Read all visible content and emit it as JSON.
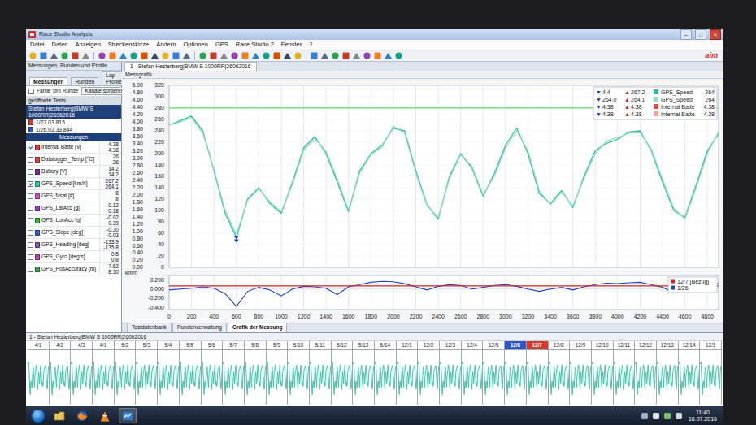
{
  "window": {
    "title": "Race Studio Analysis",
    "controls": [
      "–",
      "□",
      "×"
    ],
    "logo": "aim"
  },
  "menu": [
    "Datei",
    "Daten",
    "Anzeigen",
    "Streckenskizze",
    "Ändern",
    "Optionen",
    "GPS",
    "Race Studio 2",
    "Fenster",
    "?"
  ],
  "sidebar": {
    "title": "Messungen, Runden und Profile",
    "tabs": [
      {
        "label": "Messungen",
        "selected": true
      },
      {
        "label": "Runden",
        "selected": false
      },
      {
        "label": "Lap Profile",
        "selected": false
      }
    ],
    "color_per_lap": {
      "label": "Farbe 'pro Runde'",
      "checked": false
    },
    "sort_button": "Kanäle sortieren",
    "tests_header": "geöffnete Tests",
    "test_name": "Stefan Hesterberg|BMW S 1000RR|26062016",
    "laps": [
      {
        "label": "1/27.03.815",
        "color": "#d63a2f"
      },
      {
        "label": "1/26.02.33.844",
        "color": "#2f56c4"
      }
    ],
    "measures_header": "Messungen",
    "channels": [
      {
        "name": "Internal Batte",
        "unit": "[V]",
        "values": [
          "4.38",
          "4.38"
        ],
        "checked": true,
        "color": "#e03030"
      },
      {
        "name": "Datalogger_Temp",
        "unit": "[°C]",
        "values": [
          "26",
          "26"
        ],
        "checked": false,
        "color": "#d04848"
      },
      {
        "name": "Battery",
        "unit": "[V]",
        "values": [
          "14.2",
          "14.2"
        ],
        "checked": false,
        "color": "#7030a0"
      },
      {
        "name": "GPS_Speed",
        "unit": "[km/h]",
        "values": [
          "267.2",
          "264.1"
        ],
        "checked": true,
        "color": "#2fbf9f"
      },
      {
        "name": "GPS_Nsat",
        "unit": "[#]",
        "values": [
          "8",
          "8"
        ],
        "checked": false,
        "color": "#d050c0"
      },
      {
        "name": "GPS_LatAcc",
        "unit": "[g]",
        "values": [
          "0.12",
          "0.18"
        ],
        "checked": false,
        "color": "#9040c0"
      },
      {
        "name": "GPS_LonAcc",
        "unit": "[g]",
        "values": [
          "-0.02",
          "0.39"
        ],
        "checked": false,
        "color": "#40b040"
      },
      {
        "name": "GPS_Slope",
        "unit": "[deg]",
        "values": [
          "-0.30",
          "-0.03"
        ],
        "checked": false,
        "color": "#3060d0"
      },
      {
        "name": "GPS_Heading",
        "unit": "[deg]",
        "values": [
          "-133.9",
          "-135.8"
        ],
        "checked": false,
        "color": "#8050b0"
      },
      {
        "name": "GPS_Gyro",
        "unit": "[deg/s]",
        "values": [
          "0.5",
          "0.8"
        ],
        "checked": false,
        "color": "#c040a0"
      },
      {
        "name": "GPS_PosAccuracy",
        "unit": "[m]",
        "values": [
          "7.62",
          "8.30"
        ],
        "checked": false,
        "color": "#30a050"
      }
    ]
  },
  "chart": {
    "tab": "1 - Stefan Hesterberg|BMW S 1000RR|26062016",
    "title": "Messgrafik",
    "left_ticks": [
      "5.00",
      "4.80",
      "4.60",
      "4.40",
      "4.20",
      "4.00",
      "3.80",
      "3.60",
      "3.40",
      "3.20",
      "3.00",
      "2.80",
      "2.60",
      "2.40",
      "2.20",
      "2.00",
      "1.80",
      "1.60",
      "1.40",
      "1.20",
      "1.00",
      "0.80",
      "0.60",
      "0.40",
      "0.20",
      "0.00"
    ],
    "right_ticks": [
      "320",
      "300",
      "280",
      "260",
      "240",
      "220",
      "200",
      "180",
      "160",
      "140",
      "120",
      "100",
      "80",
      "60",
      "40",
      "20",
      "0"
    ],
    "x_ticks": [
      "0",
      "200",
      "400",
      "600",
      "800",
      "1000",
      "1200",
      "1400",
      "1600",
      "1800",
      "2000",
      "2200",
      "2400",
      "2600",
      "2800",
      "3000",
      "3200",
      "3400",
      "3600",
      "3800",
      "4000",
      "4200",
      "4400",
      "4600",
      "4800"
    ],
    "x_values": [
      0,
      100,
      200,
      300,
      400,
      500,
      600,
      700,
      800,
      900,
      1000,
      1100,
      1200,
      1300,
      1400,
      1500,
      1600,
      1700,
      1800,
      1900,
      2000,
      2100,
      2200,
      2300,
      2400,
      2500,
      2600,
      2700,
      2800,
      2900,
      3000,
      3100,
      3200,
      3300,
      3400,
      3500,
      3600,
      3700,
      3800,
      3900,
      4000,
      4100,
      4200,
      4300,
      4400,
      4500,
      4600,
      4700,
      4800,
      4900
    ],
    "series": [
      {
        "axis": "right",
        "color": "#2fbf9f",
        "values": [
          250,
          258,
          266,
          240,
          170,
          95,
          52,
          120,
          140,
          112,
          95,
          150,
          210,
          230,
          200,
          150,
          98,
          170,
          200,
          215,
          245,
          240,
          170,
          110,
          85,
          160,
          200,
          175,
          125,
          165,
          215,
          245,
          200,
          130,
          112,
          135,
          105,
          160,
          205,
          218,
          225,
          238,
          240,
          205,
          150,
          100,
          88,
          145,
          205,
          235
        ]
      },
      {
        "axis": "right",
        "color": "#8fdcc8",
        "values": [
          250,
          256,
          263,
          236,
          172,
          100,
          58,
          118,
          138,
          115,
          98,
          146,
          206,
          226,
          204,
          155,
          101,
          166,
          198,
          212,
          248,
          236,
          166,
          108,
          88,
          156,
          198,
          178,
          128,
          160,
          210,
          240,
          205,
          135,
          110,
          132,
          108,
          156,
          200,
          222,
          228,
          236,
          237,
          208,
          155,
          104,
          85,
          140,
          200,
          238
        ]
      },
      {
        "axis": "left",
        "color": "#66d466",
        "values": [
          4.38,
          4.38,
          4.38,
          4.38,
          4.38,
          4.38,
          4.38,
          4.38,
          4.38,
          4.38,
          4.38,
          4.38,
          4.38,
          4.38,
          4.38,
          4.38,
          4.38,
          4.38,
          4.38,
          4.38,
          4.38,
          4.38,
          4.38,
          4.38,
          4.38,
          4.38,
          4.38,
          4.38,
          4.38,
          4.38,
          4.38,
          4.38,
          4.38,
          4.38,
          4.38,
          4.38,
          4.38,
          4.38,
          4.38,
          4.38,
          4.38,
          4.38,
          4.38,
          4.38,
          4.38,
          4.38,
          4.38,
          4.38,
          4.38,
          4.38
        ]
      }
    ],
    "legend": [
      {
        "min_mark": "▼",
        "min": "4.4",
        "max_mark": "▲",
        "max": "267.2",
        "name": "GPS_Speed",
        "value": "264",
        "color": "#2fbf9f"
      },
      {
        "min_mark": "▼",
        "min": "264.0",
        "max_mark": "▲",
        "max": "264.1",
        "name": "GPS_Speed",
        "value": "264",
        "color": "#8fdcc8"
      },
      {
        "min_mark": "▼",
        "min": "4.38",
        "max_mark": "▲",
        "max": "4.38",
        "name": "Internal Batte",
        "value": "4.38",
        "color": "#e04848"
      },
      {
        "min_mark": "▼",
        "min": "4.38",
        "max_mark": "▲",
        "max": "4.38",
        "name": "Internal Batte",
        "value": "4.38",
        "color": "#f0a0a0"
      }
    ],
    "lower": {
      "unit": "km/h",
      "ticks": [
        "0.200",
        "0.000",
        "-0.200",
        "-0.400"
      ],
      "series": [
        {
          "color": "#2040c0",
          "values": [
            -0.02,
            0.0,
            0.02,
            0.05,
            0.02,
            -0.1,
            -0.38,
            -0.05,
            0.04,
            -0.02,
            -0.15,
            0.0,
            0.06,
            0.05,
            0.02,
            -0.12,
            0.05,
            0.1,
            0.15,
            0.17,
            0.16,
            0.12,
            0.05,
            -0.02,
            0.06,
            0.1,
            0.08,
            0.0,
            0.04,
            0.08,
            0.1,
            0.06,
            0.0,
            -0.05,
            0.0,
            0.04,
            -0.02,
            0.05,
            0.1,
            0.13,
            0.12,
            0.14,
            0.15,
            0.1,
            0.04,
            -0.08,
            0.0,
            0.08,
            0.1,
            0.12
          ]
        },
        {
          "color": "#d02020",
          "values": [
            0.07,
            0.07,
            0.07,
            0.07,
            0.07,
            0.07,
            0.07,
            0.07,
            0.07,
            0.07,
            0.07,
            0.07,
            0.07,
            0.07,
            0.07,
            0.07,
            0.07,
            0.07,
            0.07,
            0.07,
            0.07,
            0.07,
            0.07,
            0.07,
            0.07,
            0.07,
            0.07,
            0.07,
            0.07,
            0.07,
            0.07,
            0.07,
            0.07,
            0.07,
            0.07,
            0.07,
            0.07,
            0.07,
            0.07,
            0.07,
            0.07,
            0.07,
            0.07,
            0.07,
            0.07,
            0.07,
            0.07,
            0.07,
            0.07,
            0.07
          ]
        }
      ],
      "legend": [
        {
          "label": "12/7 [Bezug]",
          "color": "#d02020"
        },
        {
          "label": "1/26",
          "color": "#2040c0"
        }
      ]
    }
  },
  "bottom_tabs": [
    {
      "label": "Testdatenbank",
      "selected": false
    },
    {
      "label": "Rundenverwaltung",
      "selected": false
    },
    {
      "label": "Grafik der Messung",
      "selected": true
    }
  ],
  "strip": {
    "title": "1 - Stefan Hesterberg|BMW S 1000RR|26062016",
    "segments": [
      {
        "label": "4/1",
        "selected": false,
        "color": "#ffffff"
      },
      {
        "label": "4/2",
        "selected": false,
        "color": "#ffffff"
      },
      {
        "label": "4/3",
        "selected": false,
        "color": "#ffffff"
      },
      {
        "label": "4/1",
        "selected": false,
        "color": "#ffffff"
      },
      {
        "label": "5/2",
        "selected": false,
        "color": "#ffffff"
      },
      {
        "label": "5/3",
        "selected": false,
        "color": "#ffffff"
      },
      {
        "label": "5/4",
        "selected": false,
        "color": "#ffffff"
      },
      {
        "label": "5/5",
        "selected": false,
        "color": "#ffffff"
      },
      {
        "label": "5/6",
        "selected": false,
        "color": "#ffffff"
      },
      {
        "label": "5/7",
        "selected": false,
        "color": "#ffffff"
      },
      {
        "label": "5/8",
        "selected": false,
        "color": "#ffffff"
      },
      {
        "label": "5/9",
        "selected": false,
        "color": "#ffffff"
      },
      {
        "label": "5/10",
        "selected": false,
        "color": "#ffffff"
      },
      {
        "label": "5/11",
        "selected": false,
        "color": "#ffffff"
      },
      {
        "label": "5/12",
        "selected": false,
        "color": "#ffffff"
      },
      {
        "label": "5/13",
        "selected": false,
        "color": "#ffffff"
      },
      {
        "label": "5/14",
        "selected": false,
        "color": "#ffffff"
      },
      {
        "label": "12/1",
        "selected": false,
        "color": "#ffffff"
      },
      {
        "label": "12/2",
        "selected": false,
        "color": "#ffffff"
      },
      {
        "label": "12/3",
        "selected": false,
        "color": "#ffffff"
      },
      {
        "label": "12/4",
        "selected": false,
        "color": "#ffffff"
      },
      {
        "label": "12/5",
        "selected": false,
        "color": "#ffffff"
      },
      {
        "label": "12/6",
        "selected": true,
        "color": "#2f56c4"
      },
      {
        "label": "12/7",
        "selected": true,
        "color": "#d63a2f"
      },
      {
        "label": "12/8",
        "selected": false,
        "color": "#ffffff"
      },
      {
        "label": "12/9",
        "selected": false,
        "color": "#ffffff"
      },
      {
        "label": "12/10",
        "selected": false,
        "color": "#ffffff"
      },
      {
        "label": "12/11",
        "selected": false,
        "color": "#ffffff"
      },
      {
        "label": "12/12",
        "selected": false,
        "color": "#ffffff"
      },
      {
        "label": "12/13",
        "selected": false,
        "color": "#ffffff"
      },
      {
        "label": "12/14",
        "selected": false,
        "color": "#ffffff"
      },
      {
        "label": "12/1",
        "selected": false,
        "color": "#ffffff"
      }
    ]
  },
  "taskbar": {
    "time": "11:40",
    "date": "16.07.2016"
  }
}
